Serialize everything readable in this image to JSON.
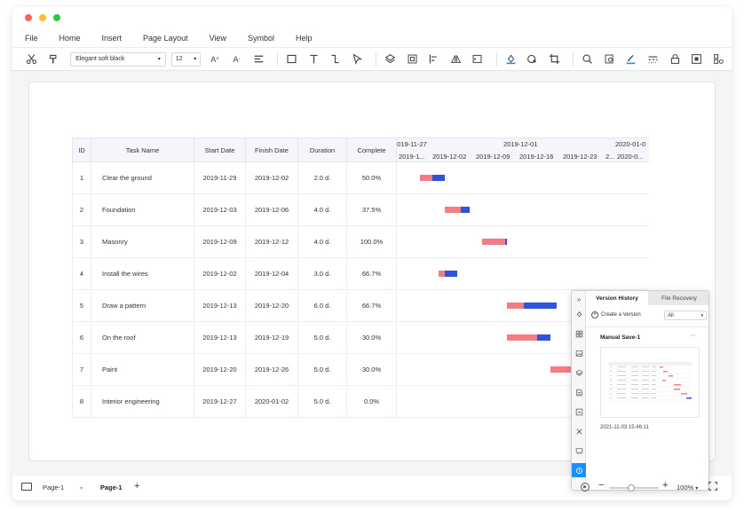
{
  "menu": [
    "File",
    "Home",
    "Insert",
    "Page Layout",
    "View",
    "Symbol",
    "Help"
  ],
  "toolbar": {
    "font": "Elegant soft black",
    "size": "12"
  },
  "colors": {
    "accent": "#1890ff",
    "bar_remaining": "#f47c84",
    "bar_complete": "#2f54d9",
    "traffic_red": "#fe5f57",
    "traffic_yellow": "#febc2e",
    "traffic_green": "#28c840"
  },
  "gantt": {
    "headers": [
      "ID",
      "Task Name",
      "Start Date",
      "Finish Date",
      "Duration",
      "Complete"
    ],
    "weeks": [
      "2019-11-27",
      "2019-12-01",
      "2020-01-0"
    ],
    "days": [
      "2019-1...",
      "2019-12-02",
      "2019-12-09",
      "2019-12-16",
      "2019-12-23",
      "2...",
      "2020-0..."
    ],
    "rows": [
      {
        "id": "1",
        "name": "Clear the ground",
        "start": "2019-11-29",
        "finish": "2019-12-02",
        "duration": "2.0 d.",
        "complete": "50.0%"
      },
      {
        "id": "2",
        "name": "Foundation",
        "start": "2019-12-03",
        "finish": "2019-12-06",
        "duration": "4.0 d.",
        "complete": "37.5%"
      },
      {
        "id": "3",
        "name": "Masonry",
        "start": "2019-12-09",
        "finish": "2019-12-12",
        "duration": "4.0 d.",
        "complete": "100.0%"
      },
      {
        "id": "4",
        "name": "Install the wires",
        "start": "2019-12-02",
        "finish": "2019-12-04",
        "duration": "3.0 d.",
        "complete": "66.7%"
      },
      {
        "id": "5",
        "name": "Draw a pattern",
        "start": "2019-12-13",
        "finish": "2019-12-20",
        "duration": "6.0 d.",
        "complete": "66.7%"
      },
      {
        "id": "6",
        "name": "On the roof",
        "start": "2019-12-13",
        "finish": "2019-12-19",
        "duration": "5.0 d.",
        "complete": "30.0%"
      },
      {
        "id": "7",
        "name": "Paint",
        "start": "2019-12-20",
        "finish": "2019-12-26",
        "duration": "5.0 d.",
        "complete": "30.0%"
      },
      {
        "id": "8",
        "name": "Interior engineering",
        "start": "2019-12-27",
        "finish": "2020-01-02",
        "duration": "5.0 d.",
        "complete": "0.0%"
      }
    ]
  },
  "version_panel": {
    "tab_history": "Version History",
    "tab_recovery": "File Recovery",
    "create_label": "Create a Version",
    "filter_value": "All",
    "item_title": "Manual Save-1",
    "item_more": "···",
    "item_time": "2021-11-03 15:46:11"
  },
  "status": {
    "page_select": "Page-1",
    "active_page": "Page-1",
    "zoom": "100%"
  },
  "icons": {
    "cut": "scissors-icon",
    "format_painter": "format-painter-icon",
    "search": "search-icon",
    "history": "history-icon"
  }
}
